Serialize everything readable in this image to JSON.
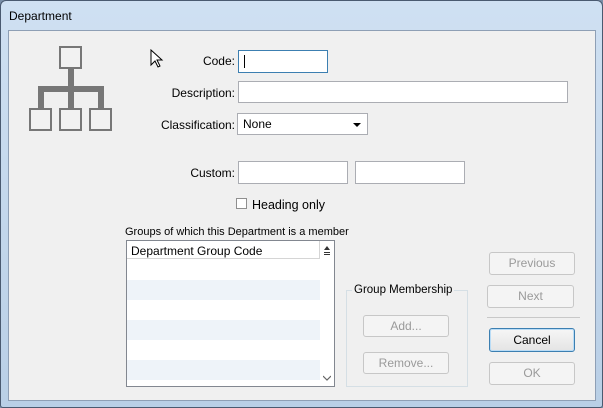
{
  "window": {
    "title": "Department"
  },
  "form": {
    "code": {
      "label": "Code:",
      "value": ""
    },
    "description": {
      "label": "Description:",
      "value": ""
    },
    "classification": {
      "label": "Classification:",
      "selected": "None"
    },
    "custom": {
      "label": "Custom:",
      "value1": "",
      "value2": ""
    },
    "heading_only": {
      "label": "Heading only",
      "checked": false
    }
  },
  "groups": {
    "caption": "Groups of which this Department is a member",
    "column_header": "Department Group Code",
    "rows": []
  },
  "membership": {
    "title": "Group Membership",
    "add_label": "Add...",
    "remove_label": "Remove..."
  },
  "nav": {
    "previous_label": "Previous",
    "next_label": "Next"
  },
  "actions": {
    "cancel_label": "Cancel",
    "ok_label": "OK"
  },
  "colors": {
    "icon_gray": "#777777",
    "accent": "#3c7fb1"
  }
}
